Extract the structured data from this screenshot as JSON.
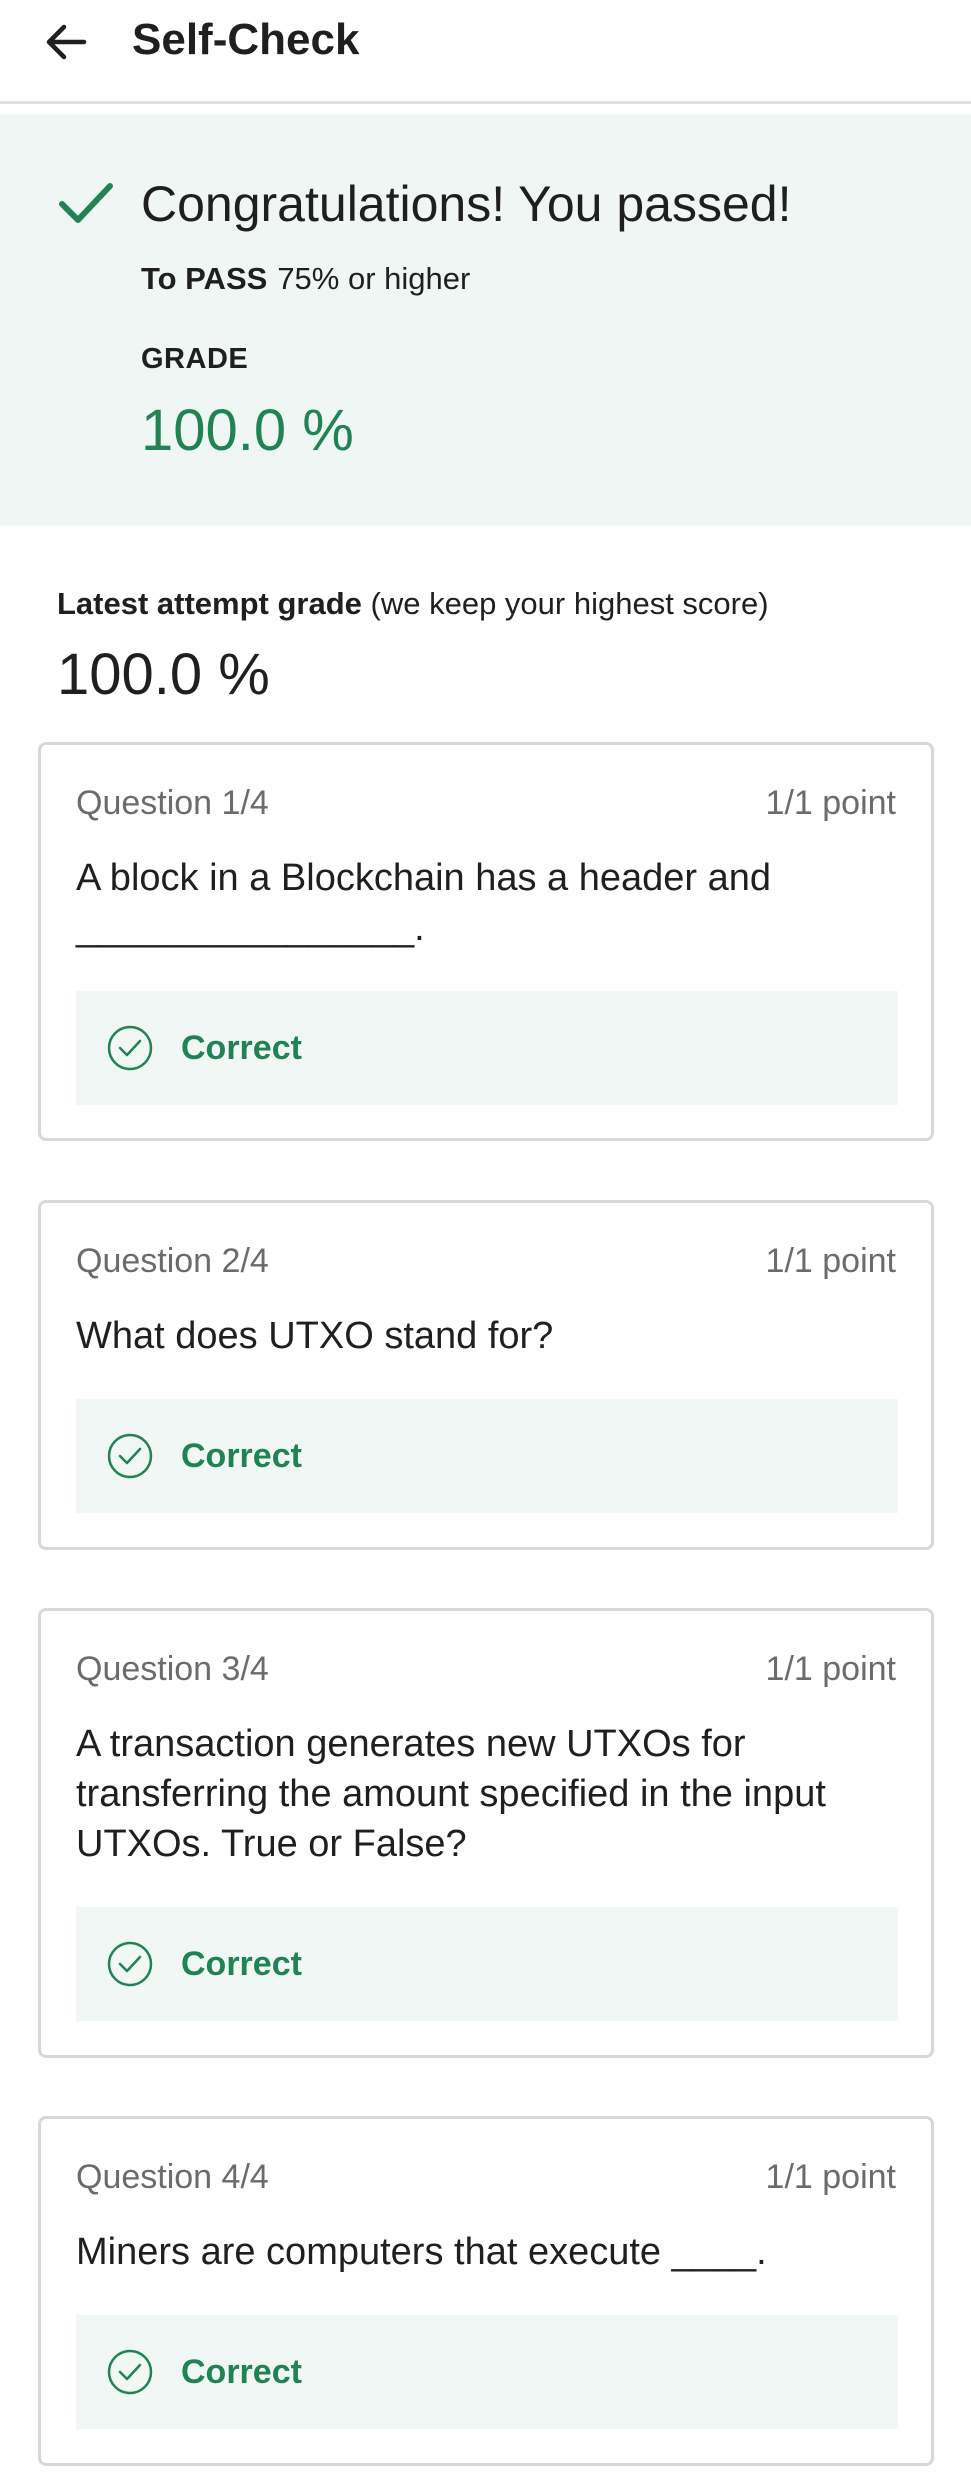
{
  "header": {
    "title": "Self-Check"
  },
  "result": {
    "title": "Congratulations! You passed!",
    "to_pass_label": "To PASS",
    "to_pass_value": "75% or higher",
    "grade_label": "GRADE",
    "grade_value": "100.0 %"
  },
  "latest": {
    "label": "Latest attempt grade",
    "note": "(we keep your highest score)",
    "value": "100.0 %"
  },
  "questions": [
    {
      "number": "Question 1/4",
      "points": "1/1 point",
      "text": "A block in a Blockchain has a header and ________________.",
      "status": "Correct"
    },
    {
      "number": "Question 2/4",
      "points": "1/1 point",
      "text": "What does UTXO stand for?",
      "status": "Correct"
    },
    {
      "number": "Question 3/4",
      "points": "1/1 point",
      "text": "A transaction generates new UTXOs for transferring the amount specified in the input UTXOs. True or False?",
      "status": "Correct"
    },
    {
      "number": "Question 4/4",
      "points": "1/1 point",
      "text": "Miners are computers that execute ____.",
      "status": "Correct"
    }
  ],
  "colors": {
    "accent_green": "#1f8354",
    "panel_bg": "#f0f6f4"
  },
  "icons": {
    "back": "arrow-left-icon",
    "pass": "checkmark-icon",
    "correct": "check-circle-icon"
  }
}
